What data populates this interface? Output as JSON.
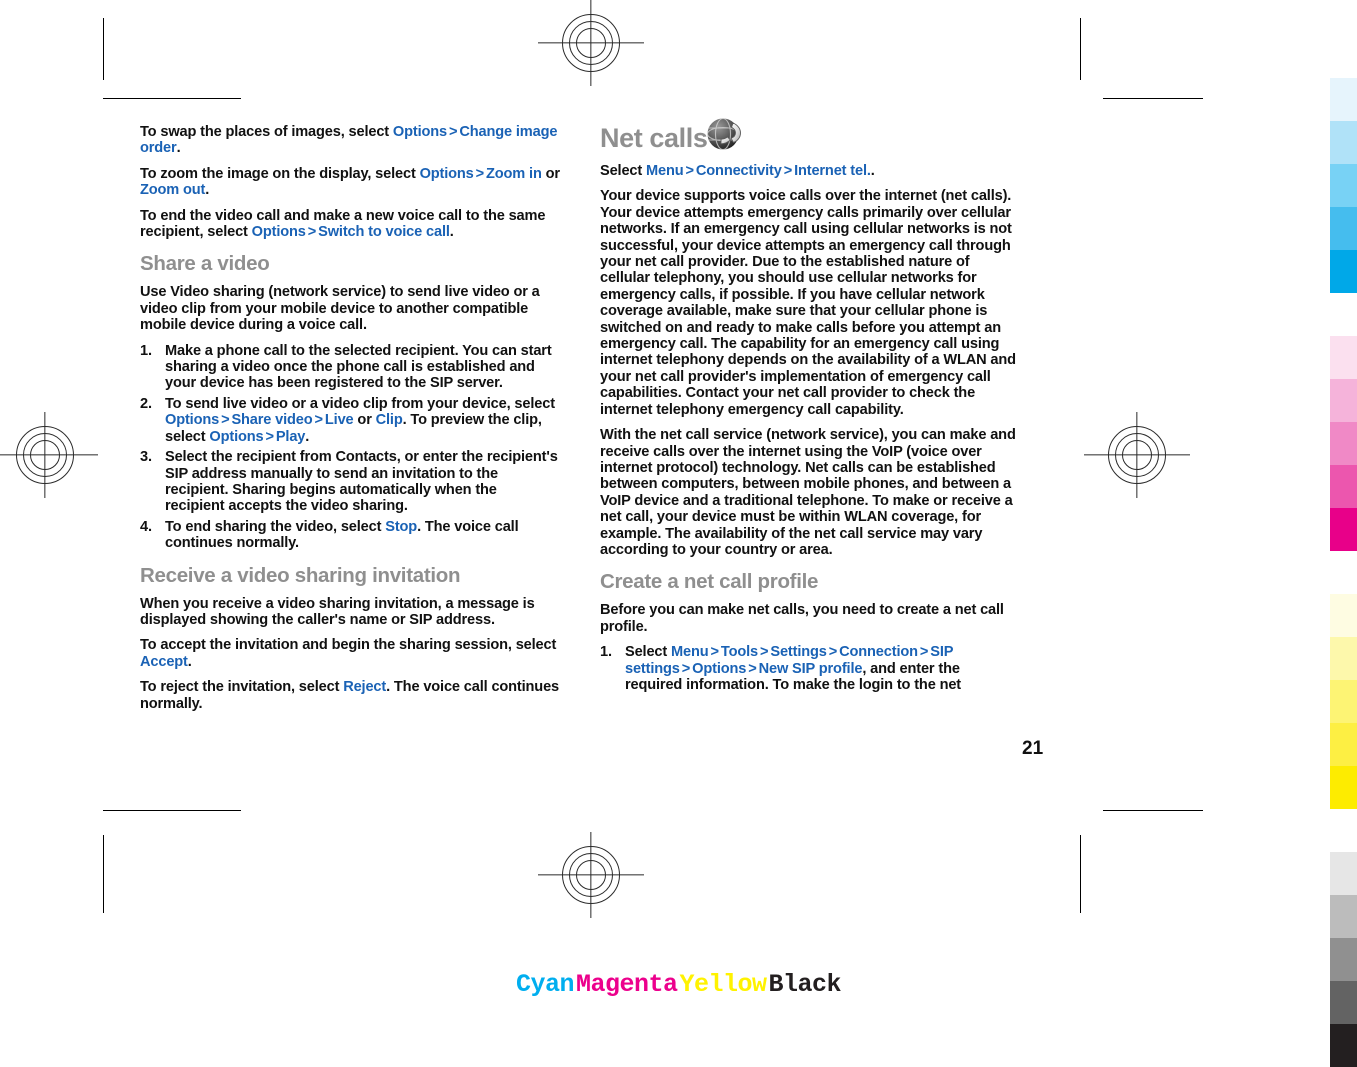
{
  "document": {
    "page_number": "21",
    "type": "prepress-proof-sheet"
  },
  "left_column": {
    "paragraphs": [
      {
        "id": "swap-images",
        "runs": [
          {
            "t": "To swap the places of images, select ",
            "s": "plain"
          },
          {
            "t": "Options",
            "s": "ui"
          },
          {
            "t": ">",
            "s": "gt"
          },
          {
            "t": "Change image order",
            "s": "ui"
          },
          {
            "t": ".",
            "s": "plain"
          }
        ]
      },
      {
        "id": "zoom-image",
        "runs": [
          {
            "t": "To zoom the image on the display, select ",
            "s": "plain"
          },
          {
            "t": "Options",
            "s": "ui"
          },
          {
            "t": ">",
            "s": "gt"
          },
          {
            "t": "Zoom in",
            "s": "ui"
          },
          {
            "t": " or ",
            "s": "plain"
          },
          {
            "t": "Zoom out",
            "s": "ui"
          },
          {
            "t": ".",
            "s": "plain"
          }
        ]
      },
      {
        "id": "end-video-call",
        "runs": [
          {
            "t": "To end the video call and make a new voice call to the same recipient, select ",
            "s": "plain"
          },
          {
            "t": "Options",
            "s": "ui"
          },
          {
            "t": ">",
            "s": "gt"
          },
          {
            "t": "Switch to voice call",
            "s": "ui"
          },
          {
            "t": ".",
            "s": "plain"
          }
        ]
      }
    ],
    "heading_share_video": "Share a video",
    "share_video_intro": {
      "id": "share-video-intro",
      "runs": [
        {
          "t": "Use Video sharing (network service) to send live video or a video clip from your mobile device to another compatible mobile device during a voice call.",
          "s": "plain"
        }
      ]
    },
    "share_video_steps": [
      {
        "num": "1.",
        "runs": [
          {
            "t": "Make a phone call to the selected recipient. You can start sharing a video once the phone call is established and your device has been registered to the SIP server.",
            "s": "plain"
          }
        ]
      },
      {
        "num": "2.",
        "runs": [
          {
            "t": "To send live video or a video clip from your device, select ",
            "s": "plain"
          },
          {
            "t": "Options",
            "s": "ui"
          },
          {
            "t": ">",
            "s": "gt"
          },
          {
            "t": "Share video",
            "s": "ui"
          },
          {
            "t": ">",
            "s": "gt"
          },
          {
            "t": "Live",
            "s": "ui"
          },
          {
            "t": " or ",
            "s": "plain"
          },
          {
            "t": "Clip",
            "s": "ui"
          },
          {
            "t": ". To preview the clip, select ",
            "s": "plain"
          },
          {
            "t": "Options",
            "s": "ui"
          },
          {
            "t": ">",
            "s": "gt"
          },
          {
            "t": "Play",
            "s": "ui"
          },
          {
            "t": ".",
            "s": "plain"
          }
        ]
      },
      {
        "num": "3.",
        "runs": [
          {
            "t": "Select the recipient from Contacts, or enter the recipient's SIP address manually to send an invitation to the recipient. Sharing begins automatically when the recipient accepts the video sharing.",
            "s": "plain"
          }
        ]
      },
      {
        "num": "4.",
        "runs": [
          {
            "t": "To end sharing the video, select ",
            "s": "plain"
          },
          {
            "t": "Stop",
            "s": "ui"
          },
          {
            "t": ". The voice call continues normally.",
            "s": "plain"
          }
        ]
      }
    ],
    "heading_receive_invitation": "Receive a video sharing invitation",
    "receive_paragraphs": [
      {
        "id": "invitation-displayed",
        "runs": [
          {
            "t": "When you receive a video sharing invitation, a message is displayed showing the caller's name or SIP address.",
            "s": "plain"
          }
        ]
      },
      {
        "id": "accept-invitation",
        "runs": [
          {
            "t": "To accept the invitation and begin the sharing session, select ",
            "s": "plain"
          },
          {
            "t": "Accept",
            "s": "ui"
          },
          {
            "t": ".",
            "s": "plain"
          }
        ]
      },
      {
        "id": "reject-invitation",
        "runs": [
          {
            "t": "To reject the invitation, select ",
            "s": "plain"
          },
          {
            "t": "Reject",
            "s": "ui"
          },
          {
            "t": ". The voice call continues normally.",
            "s": "plain"
          }
        ]
      }
    ]
  },
  "right_column": {
    "chapter_title": "Net calls",
    "chapter_icon": "globe-phone-icon",
    "menu_path": {
      "id": "net-calls-path",
      "runs": [
        {
          "t": "Select ",
          "s": "plain"
        },
        {
          "t": "Menu",
          "s": "ui"
        },
        {
          "t": ">",
          "s": "gt"
        },
        {
          "t": "Connectivity",
          "s": "ui"
        },
        {
          "t": ">",
          "s": "gt"
        },
        {
          "t": "Internet tel.",
          "s": "ui"
        },
        {
          "t": ".",
          "s": "plain"
        }
      ]
    },
    "paragraphs": [
      {
        "id": "emergency-calls-notice",
        "runs": [
          {
            "t": "Your device supports voice calls over the internet (net calls). Your device attempts emergency calls primarily over cellular networks. If an emergency call using cellular networks is not successful, your device attempts an emergency call through your net call provider. Due to the established nature of cellular telephony, you should use cellular networks for emergency calls, if possible. If you have cellular network coverage available, make sure that your cellular phone is switched on and ready to make calls before you attempt an emergency call. The capability for an emergency call using internet telephony depends on the availability of a WLAN and your net call provider's implementation of emergency call capabilities. Contact your net call provider to check the internet telephony emergency call capability.",
            "s": "plain"
          }
        ]
      },
      {
        "id": "net-call-service-info",
        "runs": [
          {
            "t": "With the net call service (network service), you can make and receive calls over the internet using the VoIP (voice over internet protocol) technology. Net calls can be established between computers, between mobile phones, and between a VoIP device and a traditional telephone. To make or receive a net call, your device must be within WLAN coverage, for example. The availability of the net call service may vary according to your country or area.",
            "s": "plain"
          }
        ]
      }
    ],
    "heading_create_profile": "Create a net call profile",
    "create_profile_intro": {
      "id": "create-profile-intro",
      "runs": [
        {
          "t": "Before you can make net calls, you need to create a net call profile.",
          "s": "plain"
        }
      ]
    },
    "create_profile_steps": [
      {
        "num": "1.",
        "runs": [
          {
            "t": "Select ",
            "s": "plain"
          },
          {
            "t": "Menu",
            "s": "ui"
          },
          {
            "t": ">",
            "s": "gt"
          },
          {
            "t": "Tools",
            "s": "ui"
          },
          {
            "t": ">",
            "s": "gt"
          },
          {
            "t": "Settings",
            "s": "ui"
          },
          {
            "t": ">",
            "s": "gt"
          },
          {
            "t": "Connection",
            "s": "ui"
          },
          {
            "t": ">",
            "s": "gt"
          },
          {
            "t": "SIP settings",
            "s": "ui"
          },
          {
            "t": ">",
            "s": "gt"
          },
          {
            "t": "Options",
            "s": "ui"
          },
          {
            "t": ">",
            "s": "gt"
          },
          {
            "t": "New SIP profile",
            "s": "ui"
          },
          {
            "t": ", and enter the required information. To make the login to the net",
            "s": "plain"
          }
        ]
      }
    ]
  },
  "color_bar": {
    "labels": [
      {
        "text": "Cyan",
        "color": "#00aeef"
      },
      {
        "text": "Magenta",
        "color": "#ec008c"
      },
      {
        "text": "Yellow",
        "color": "#fff200"
      },
      {
        "text": "Black",
        "color": "#231f20"
      }
    ]
  },
  "calibration_strip": {
    "swatches": [
      "#e6f4fc",
      "#b0e2f8",
      "#78d2f5",
      "#45bdee",
      "#00a8e8",
      "#ffffff",
      "#fbe0ef",
      "#f5b3da",
      "#f089c6",
      "#ec56ae",
      "#e80089",
      "#ffffff",
      "#fefce2",
      "#fdf8ab",
      "#fdf474",
      "#fdef43",
      "#fdec00",
      "#ffffff",
      "#e6e6e6",
      "#bcbcbc",
      "#909090",
      "#636363",
      "#231f20"
    ]
  },
  "accents": {
    "ui_link_blue": "#1a62b5",
    "heading_gray": "#8f8f8f",
    "body_black": "#111111"
  }
}
